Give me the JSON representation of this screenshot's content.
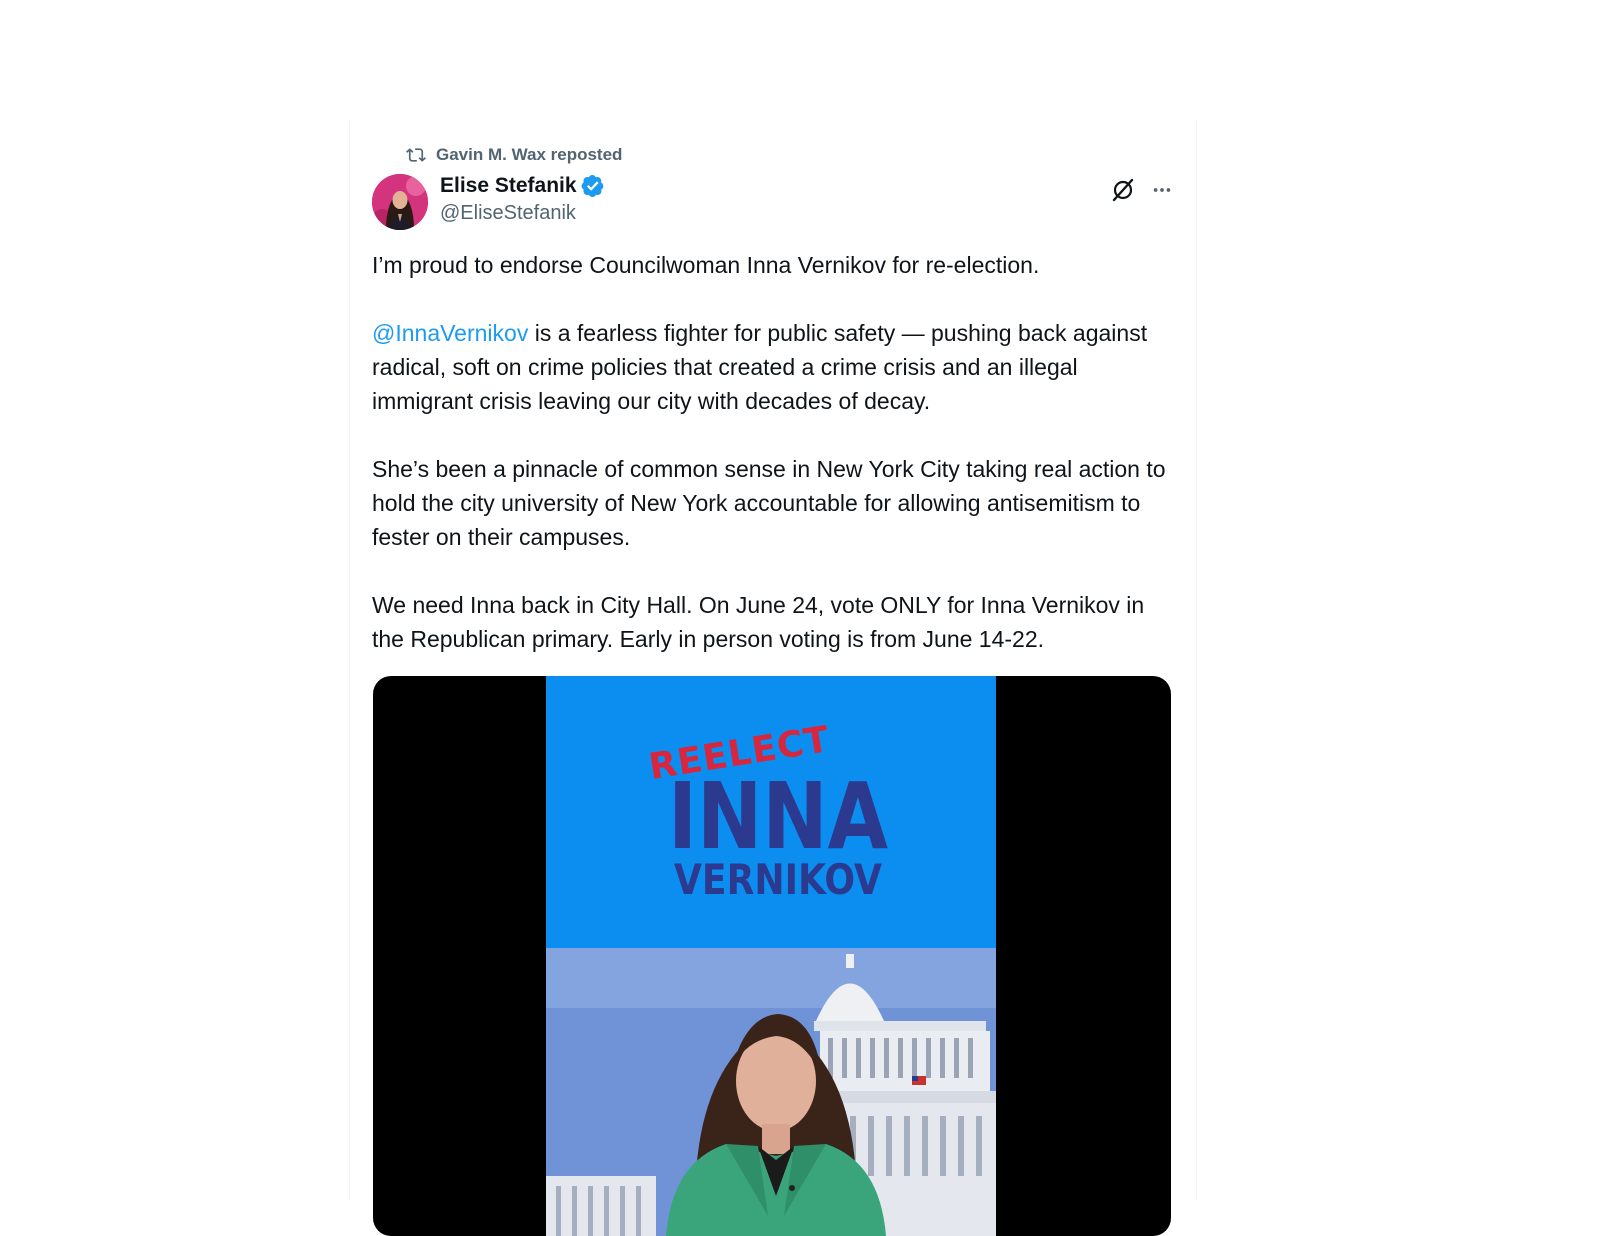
{
  "repost": {
    "text": "Gavin M. Wax reposted",
    "icon": "repost-icon"
  },
  "author": {
    "name": "Elise Stefanik",
    "handle": "@EliseStefanik",
    "verified": true
  },
  "actions": {
    "grok_icon": "grok-icon",
    "more_icon": "more-icon"
  },
  "tweet": {
    "p1": "I’m proud to endorse Councilwoman Inna Vernikov for re-election.",
    "p2_mention": "@InnaVernikov",
    "p2_rest": " is a fearless fighter for public safety — pushing back against radical, soft on crime policies that created a crime crisis and an illegal immigrant crisis leaving our city with decades of decay.",
    "p3": "She’s been a pinnacle of common sense in New York City taking real action to hold the city university of New York accountable for allowing antisemitism to fester on their campuses.",
    "p4": "We need Inna back in City Hall. On June 24, vote ONLY for Inna Vernikov in the Republican primary. Early in person voting is from June 14-22."
  },
  "video": {
    "graphic_line1": "REELECT",
    "graphic_line2": "INNA",
    "graphic_line3": "VERNIKOV"
  },
  "colors": {
    "link": "#1d9bf0",
    "secondary_text": "#536471",
    "video_top_bg": "#0b8ef0",
    "reelect_red": "#d7263d",
    "inna_navy": "#2b3a8f",
    "jacket_green": "#3aa57a"
  }
}
